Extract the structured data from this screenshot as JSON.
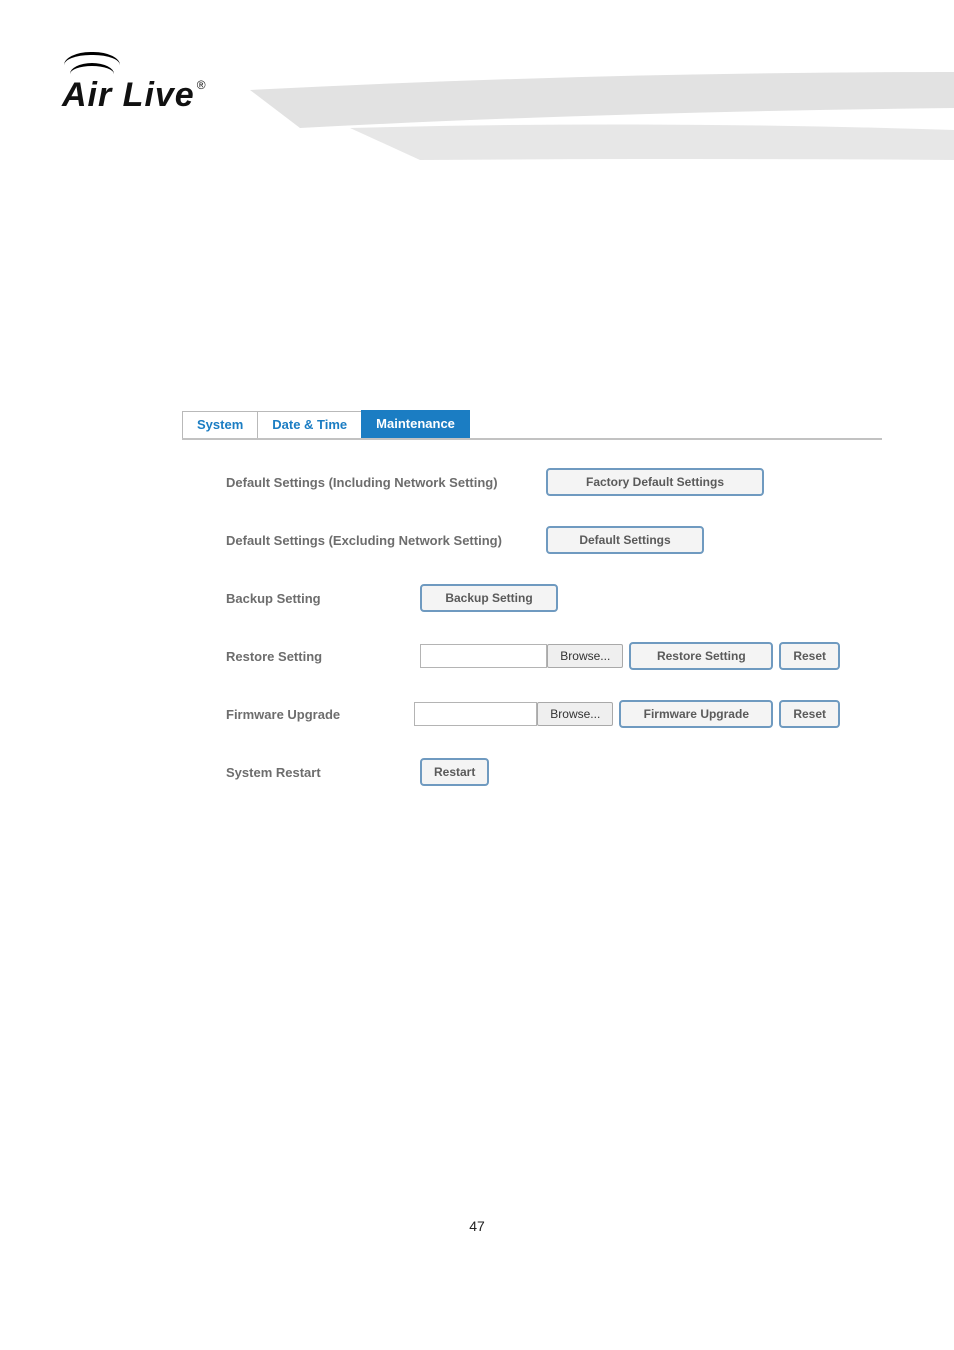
{
  "logo": {
    "text": "Air Live",
    "registered": "®"
  },
  "tabs": [
    {
      "label": "System"
    },
    {
      "label": "Date & Time"
    },
    {
      "label": "Maintenance",
      "active": true
    }
  ],
  "form": {
    "row1": {
      "label": "Default Settings (Including Network Setting)",
      "button": "Factory Default Settings"
    },
    "row2": {
      "label": "Default Settings (Excluding Network Setting)",
      "button": "Default Settings"
    },
    "row3": {
      "label": "Backup Setting",
      "button": "Backup Setting"
    },
    "row4": {
      "label": "Restore Setting",
      "browse": "Browse...",
      "action": "Restore Setting",
      "reset": "Reset"
    },
    "row5": {
      "label": "Firmware Upgrade",
      "browse": "Browse...",
      "action": "Firmware Upgrade",
      "reset": "Reset"
    },
    "row6": {
      "label": "System Restart",
      "button": "Restart"
    }
  },
  "page_number": "47"
}
